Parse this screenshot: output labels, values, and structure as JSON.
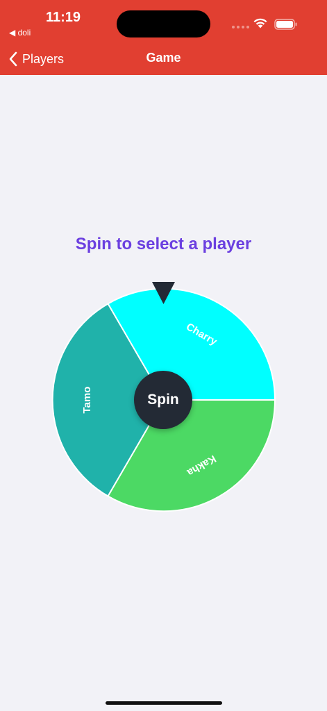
{
  "status_bar": {
    "time": "11:19",
    "back_app": "◀ doli"
  },
  "nav": {
    "back_label": "Players",
    "title": "Game"
  },
  "prompt": "Spin to select a player",
  "wheel": {
    "segments": [
      {
        "name": "Charry",
        "color": "#00FFFF"
      },
      {
        "name": "Kakha",
        "color": "#4CD964"
      },
      {
        "name": "Tamo",
        "color": "#20B2AA"
      }
    ],
    "spin_label": "Spin"
  },
  "colors": {
    "header": "#E13F31",
    "prompt": "#6B3FE0",
    "spin_button": "#232A35",
    "background": "#F2F2F7"
  }
}
